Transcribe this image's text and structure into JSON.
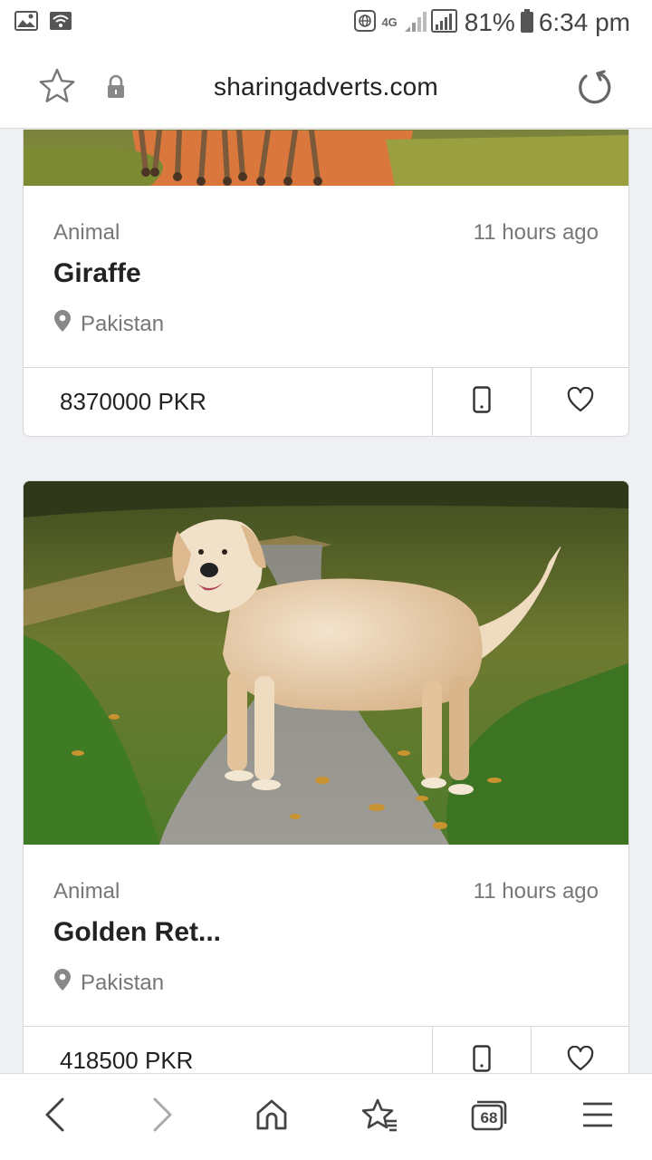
{
  "status_bar": {
    "network": "4G",
    "battery": "81%",
    "time": "6:34 pm"
  },
  "browser": {
    "url": "sharingadverts.com",
    "tab_count": "68"
  },
  "listings": [
    {
      "category": "Animal",
      "time_ago": "11 hours ago",
      "title": "Giraffe",
      "location": "Pakistan",
      "price": "8370000 PKR"
    },
    {
      "category": "Animal",
      "time_ago": "11 hours ago",
      "title": "Golden Ret...",
      "location": "Pakistan",
      "price": "418500 PKR"
    }
  ],
  "colors": {
    "background": "#eef0f4",
    "card": "#ffffff",
    "muted_text": "#777777",
    "border": "#d8d8d8"
  }
}
